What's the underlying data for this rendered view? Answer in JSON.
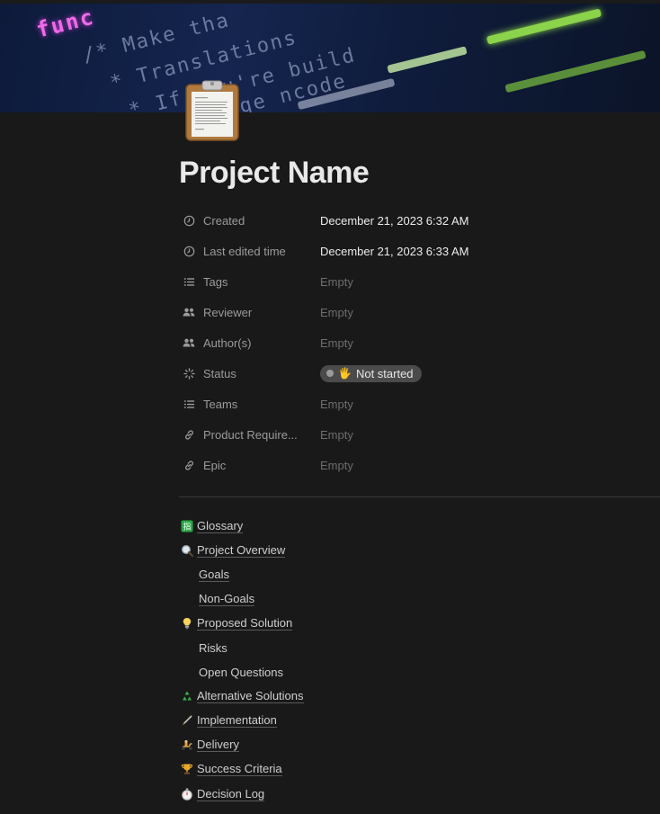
{
  "page": {
    "title": "Project Name",
    "icon": "clipboard-icon"
  },
  "properties": [
    {
      "name": "Created",
      "icon": "clock-icon",
      "value": "December 21, 2023 6:32 AM",
      "empty": false
    },
    {
      "name": "Last edited time",
      "icon": "clock-icon",
      "value": "December 21, 2023 6:33 AM",
      "empty": false
    },
    {
      "name": "Tags",
      "icon": "list-icon",
      "value": "Empty",
      "empty": true
    },
    {
      "name": "Reviewer",
      "icon": "people-icon",
      "value": "Empty",
      "empty": true
    },
    {
      "name": "Author(s)",
      "icon": "people-icon",
      "value": "Empty",
      "empty": true
    },
    {
      "name": "Status",
      "icon": "status-loader-icon",
      "value": "Not started",
      "emoji": "🖐",
      "empty": false
    },
    {
      "name": "Teams",
      "icon": "list-icon",
      "value": "Empty",
      "empty": true
    },
    {
      "name": "Product Require...",
      "icon": "link-icon",
      "value": "Empty",
      "empty": true
    },
    {
      "name": "Epic",
      "icon": "link-icon",
      "value": "Empty",
      "empty": true
    }
  ],
  "toc": [
    {
      "label": "Glossary",
      "emoji": "🈯",
      "level": 1
    },
    {
      "label": "Project Overview",
      "emoji": "🔍",
      "level": 1
    },
    {
      "label": "Goals",
      "emoji": "",
      "level": 2
    },
    {
      "label": "Non-Goals",
      "emoji": "",
      "level": 2
    },
    {
      "label": "Proposed Solution",
      "emoji": "💡",
      "level": 1
    },
    {
      "label": "Risks",
      "emoji": "",
      "level": 2
    },
    {
      "label": "Open Questions",
      "emoji": "",
      "level": 2
    },
    {
      "label": "Alternative Solutions",
      "emoji": "♻️",
      "level": 1
    },
    {
      "label": "Implementation",
      "emoji": "🖊",
      "level": 1
    },
    {
      "label": "Delivery",
      "emoji": "🛵",
      "level": 1
    },
    {
      "label": "Success Criteria",
      "emoji": "🏆",
      "level": 1
    },
    {
      "label": "Decision Log",
      "emoji": "⏱",
      "level": 1
    }
  ],
  "cover": {
    "code_lines": [
      "func",
      "/* Make tha",
      "* Translations",
      "* If you're build",
      "* Le  ange  ncode"
    ]
  },
  "colors": {
    "background": "#191919",
    "status_pill": "#4b4b4b",
    "code_green": "#8bd34a",
    "code_pink": "#f06be8"
  }
}
